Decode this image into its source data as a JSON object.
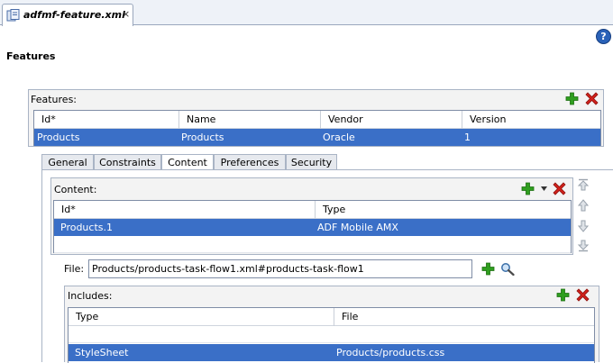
{
  "editor_tab": {
    "title": "adfmf-feature.xml",
    "close": "×"
  },
  "help": {
    "label": "?"
  },
  "page": {
    "title": "Features"
  },
  "features": {
    "label": "Features:",
    "columns": [
      "Id*",
      "Name",
      "Vendor",
      "Version"
    ],
    "rows": [
      {
        "id": "Products",
        "name": "Products",
        "vendor": "Oracle",
        "version": "1"
      }
    ]
  },
  "subtabs": [
    "General",
    "Constraints",
    "Content",
    "Preferences",
    "Security"
  ],
  "active_subtab": "Content",
  "content": {
    "label": "Content:",
    "columns": [
      "Id*",
      "Type"
    ],
    "rows": [
      {
        "id": "Products.1",
        "type": "ADF Mobile AMX"
      }
    ]
  },
  "file": {
    "label": "File:",
    "value": "Products/products-task-flow1.xml#products-task-flow1"
  },
  "includes": {
    "label": "Includes:",
    "columns": [
      "Type",
      "File"
    ],
    "rows": [
      {
        "type": "StyleSheet",
        "file": "Products/products.css"
      }
    ]
  },
  "colors": {
    "selection": "#3a6fc7",
    "add": "#2f9e1f",
    "delete": "#d0201a",
    "help": "#2a62b8"
  }
}
